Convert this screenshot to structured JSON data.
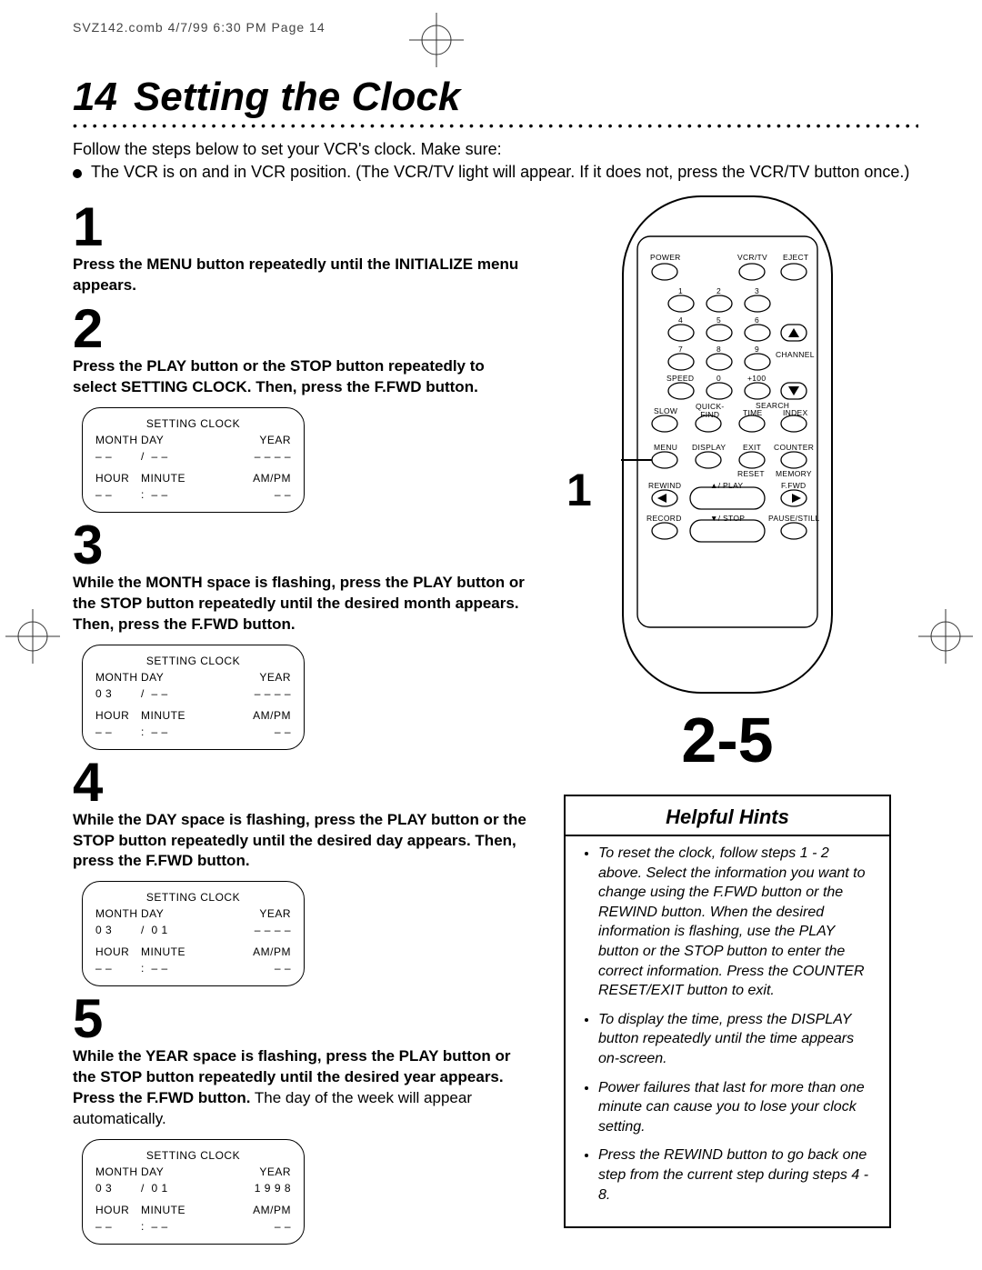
{
  "slug": "SVZ142.comb  4/7/99  6:30 PM  Page 14",
  "title": {
    "num": "14",
    "text": "Setting the Clock"
  },
  "intro": "Follow the steps below to set your VCR's clock.  Make sure:",
  "intro_bullet": "The VCR is on and in VCR position. (The VCR/TV light will appear. If it does not, press the VCR/TV button once.)",
  "steps": {
    "s1": {
      "num": "1",
      "text": "Press the MENU button repeatedly until the INITIALIZE menu appears."
    },
    "s2": {
      "num": "2",
      "text": "Press the PLAY button or the STOP button repeatedly to select SETTING CLOCK. Then, press the F.FWD button."
    },
    "s3": {
      "num": "3",
      "text": "While the MONTH space is flashing, press the PLAY button or the STOP button repeatedly until the desired month appears. Then, press the F.FWD button."
    },
    "s4": {
      "num": "4",
      "text": "While the DAY space is flashing, press the PLAY button or the STOP button repeatedly until the desired day appears. Then, press the F.FWD button."
    },
    "s5": {
      "num": "5",
      "text": "While the YEAR space is flashing, press the PLAY button or the STOP button repeatedly until the desired year appears. Press the F.FWD button.",
      "tail": " The day of the week will appear automatically."
    }
  },
  "osd_labels": {
    "title": "SETTING CLOCK",
    "month": "MONTH",
    "day": "DAY",
    "year": "YEAR",
    "hour": "HOUR",
    "minute": "MINUTE",
    "ampm": "AM/PM"
  },
  "osd_values": {
    "screen2": {
      "month": "– –",
      "sep": "/",
      "day": "– –",
      "year": "– – – –",
      "hour": "– –",
      "min": "– –",
      "ampm": "– –"
    },
    "screen3": {
      "month": "0 3",
      "sep": "/",
      "day": "– –",
      "year": "– – – –",
      "hour": "– –",
      "min": "– –",
      "ampm": "– –"
    },
    "screen4": {
      "month": "0 3",
      "sep": "/",
      "day": "0 1",
      "year": "– – – –",
      "hour": "– –",
      "min": "– –",
      "ampm": "– –"
    },
    "screen5": {
      "month": "0 3",
      "sep": "/",
      "day": "0 1",
      "year": "1 9 9 8",
      "hour": "– –",
      "min": "– –",
      "ampm": "– –"
    }
  },
  "remote": {
    "labels": {
      "power": "POWER",
      "vcrtv": "VCR/TV",
      "eject": "EJECT",
      "n1": "1",
      "n2": "2",
      "n3": "3",
      "n4": "4",
      "n5": "5",
      "n6": "6",
      "n7": "7",
      "n8": "8",
      "n9": "9",
      "n0": "0",
      "channel": "CHANNEL",
      "speed": "SPEED",
      "plus100": "+100",
      "slow": "SLOW",
      "quickfind": "QUICK-\nFIND",
      "search": "SEARCH",
      "time": "TIME",
      "index": "INDEX",
      "menu": "MENU",
      "display": "DISPLAY",
      "exit": "EXIT",
      "counter": "COUNTER",
      "reset": "RESET",
      "memory": "MEMORY",
      "rewind": "REWIND",
      "play": "▲/ PLAY",
      "ffwd": "F.FWD",
      "record": "RECORD",
      "stop": "▼/ STOP",
      "pause": "PAUSE/STILL"
    }
  },
  "callouts": {
    "one": "1",
    "two_five": "2-5"
  },
  "hints": {
    "title": "Helpful Hints",
    "items": [
      "To reset the clock, follow steps 1 - 2 above. Select the information you want to change using the F.FWD button or the REWIND button. When the desired information is flashing, use the PLAY button or the STOP button to enter the correct information. Press the COUNTER RESET/EXIT button to exit.",
      "To display the time, press the DISPLAY button repeatedly until the time appears on-screen.",
      "Power failures that last for more than one minute can cause you to lose your clock setting.",
      "Press the REWIND button to go back one step from the current step during steps 4 - 8."
    ]
  }
}
